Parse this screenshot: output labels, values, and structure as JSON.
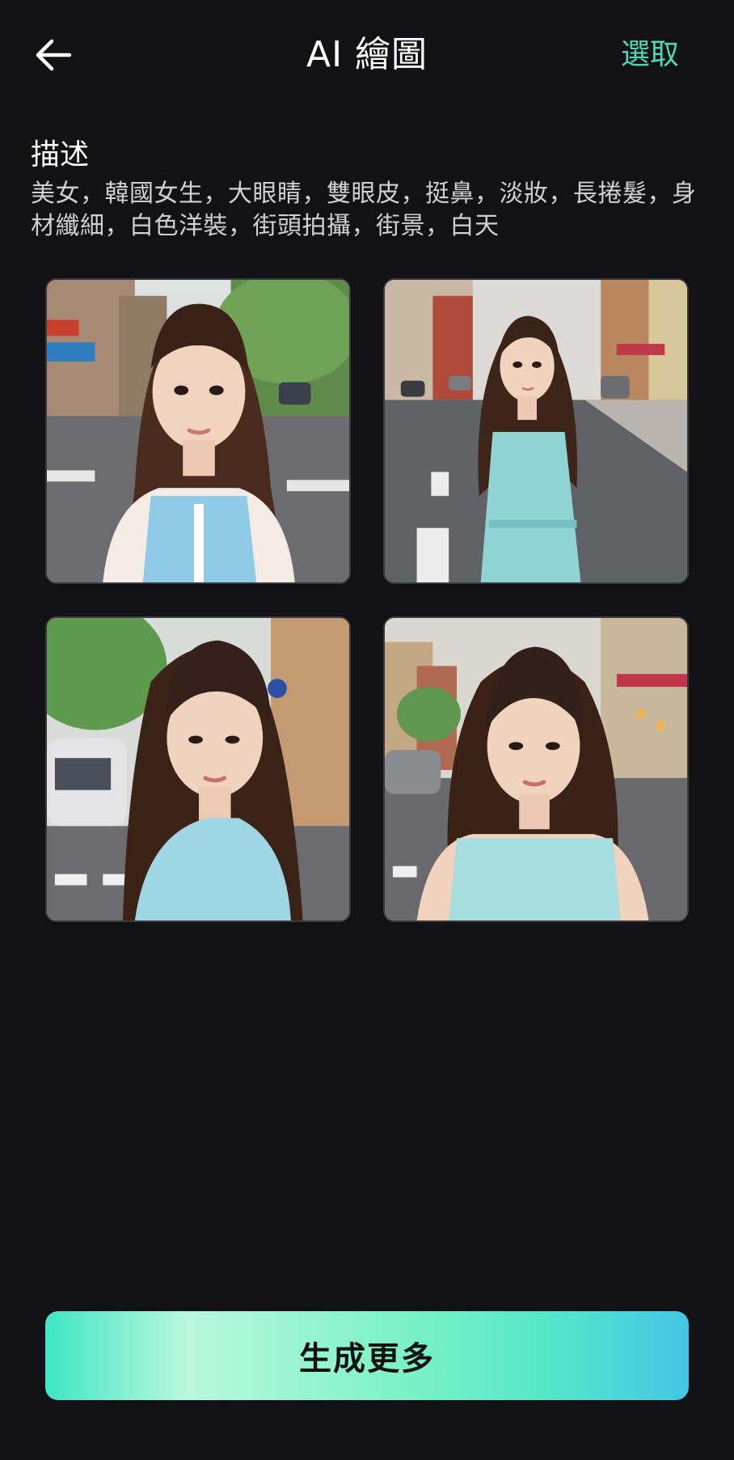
{
  "header": {
    "back_icon": "arrow-left-icon",
    "title": "AI 繪圖",
    "select_label": "選取"
  },
  "description": {
    "heading": "描述",
    "text": "美女，韓國女生，大眼睛，雙眼皮，挺鼻，淡妝，長捲髮，身材纖細，白色洋裝，街頭拍攝，街景，白天"
  },
  "images": [
    {
      "id": "portrait-1"
    },
    {
      "id": "portrait-2"
    },
    {
      "id": "portrait-3"
    },
    {
      "id": "portrait-4"
    }
  ],
  "actions": {
    "generate_more_label": "生成更多"
  },
  "colors": {
    "background": "#121214",
    "accent": "#4fd6b8",
    "button_gradient_start": "#3fe6c3",
    "button_gradient_end": "#43c6e6"
  }
}
